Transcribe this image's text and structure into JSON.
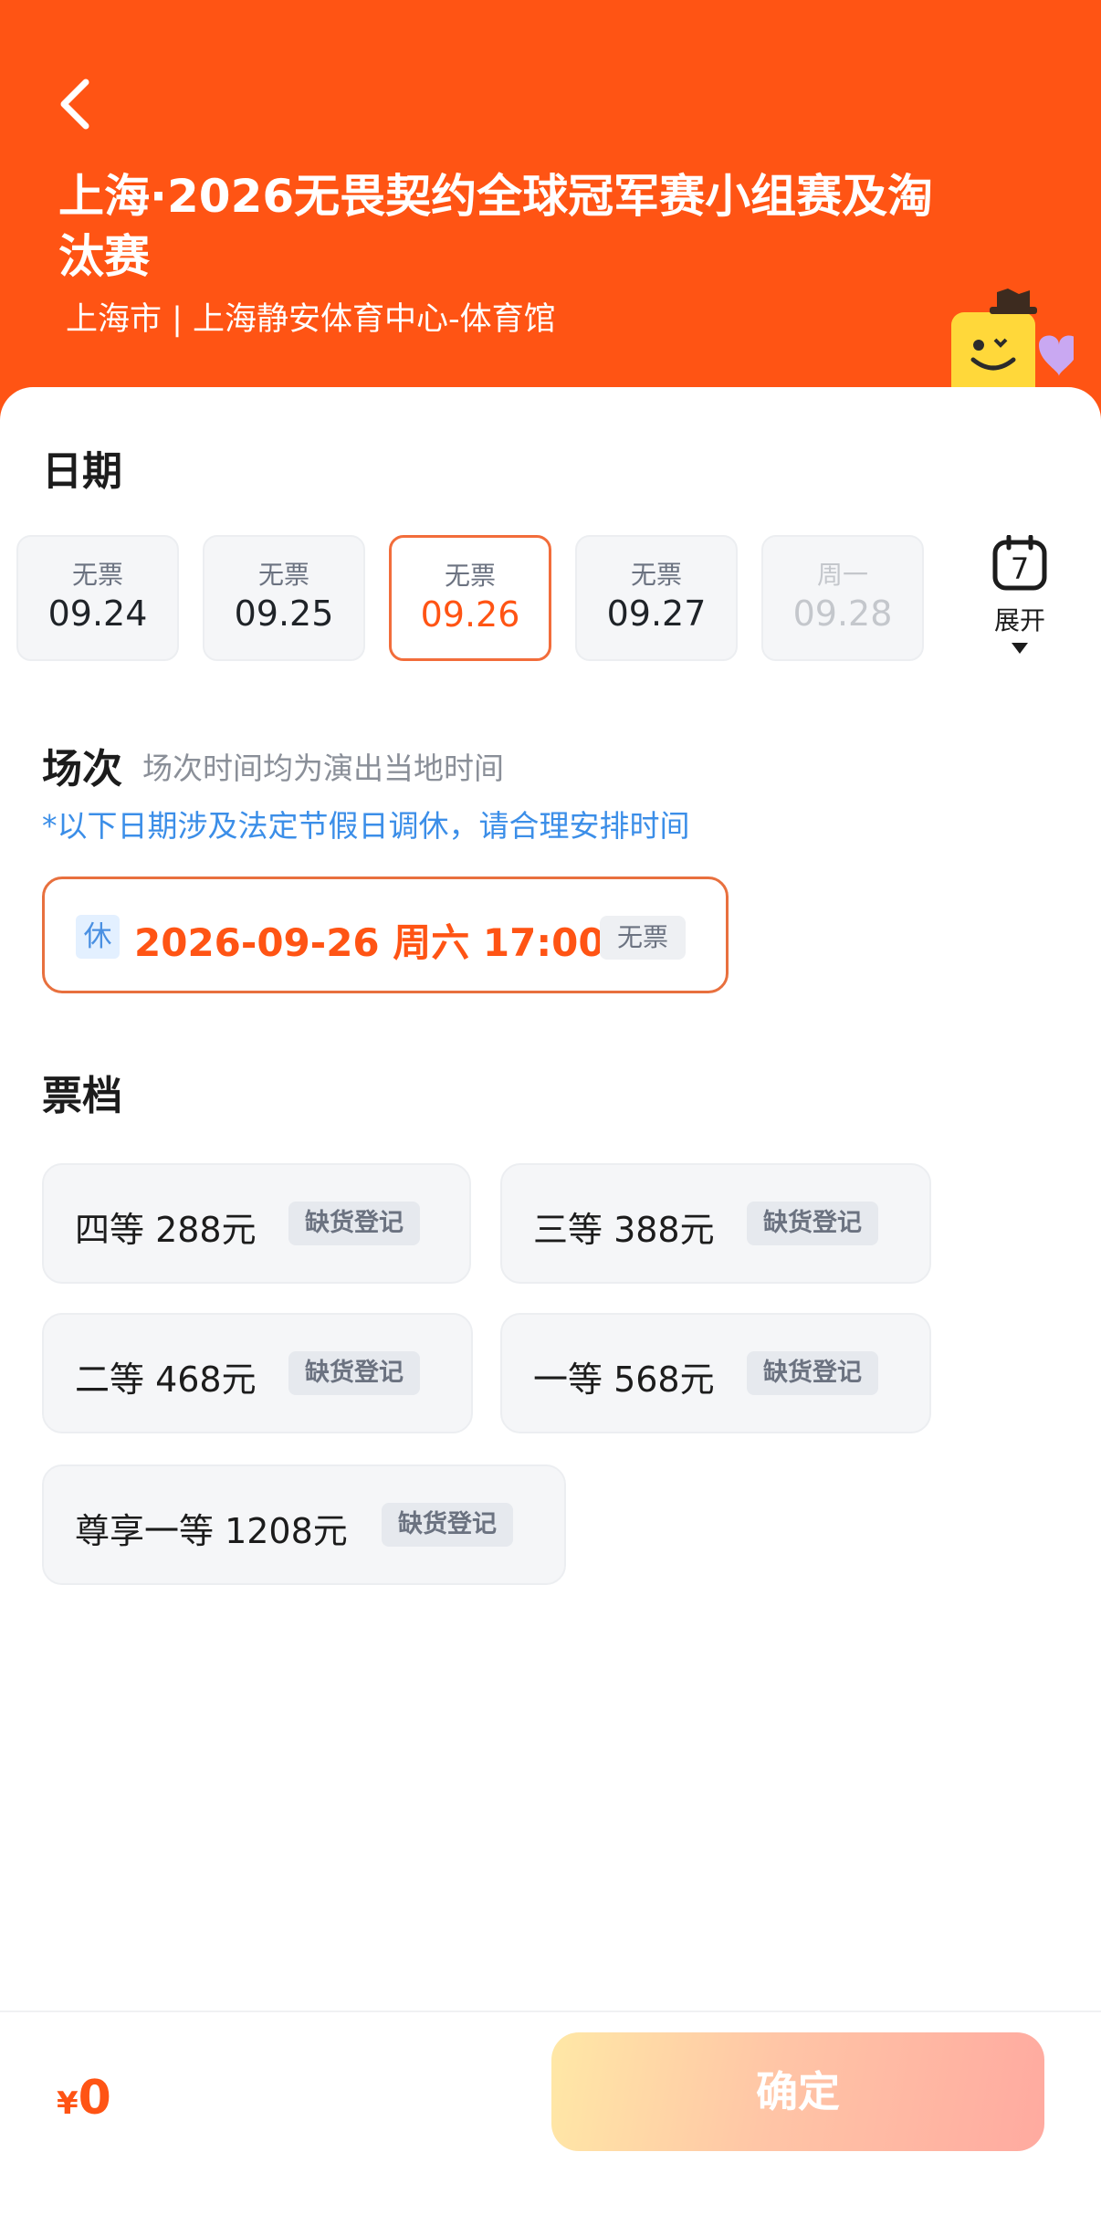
{
  "header": {
    "title": "上海·2026无畏契约全球冠军赛小组赛及淘汰赛",
    "venue": "上海市 | 上海静安体育中心-体育馆",
    "background_color": "#ff5414"
  },
  "date_section": {
    "title": "日期",
    "dates": [
      {
        "label": "无票",
        "date": "09.24",
        "state": "normal"
      },
      {
        "label": "无票",
        "date": "09.25",
        "state": "normal"
      },
      {
        "label": "无票",
        "date": "09.26",
        "state": "selected"
      },
      {
        "label": "无票",
        "date": "09.27",
        "state": "normal"
      },
      {
        "label": "周一",
        "date": "09.28",
        "state": "disabled"
      }
    ],
    "expand_icon_number": "7",
    "expand_label": "展开"
  },
  "session_section": {
    "title": "场次",
    "hint": "场次时间均为演出当地时间",
    "holiday_note": "*以下日期涉及法定节假日调休，请合理安排时间",
    "session": {
      "rest_badge": "休",
      "text": "2026-09-26 周六 17:00",
      "status": "无票"
    }
  },
  "tier_section": {
    "title": "票档",
    "tiers": [
      {
        "name": "四等 288元",
        "badge": "缺货登记"
      },
      {
        "name": "三等 388元",
        "badge": "缺货登记"
      },
      {
        "name": "二等 468元",
        "badge": "缺货登记"
      },
      {
        "name": "一等 568元",
        "badge": "缺货登记"
      },
      {
        "name": "尊享一等 1208元",
        "badge": "缺货登记"
      }
    ]
  },
  "footer": {
    "currency": "¥",
    "total": "0",
    "confirm_label": "确定"
  },
  "colors": {
    "accent": "#ff5414",
    "link_blue": "#3b8ee8"
  }
}
